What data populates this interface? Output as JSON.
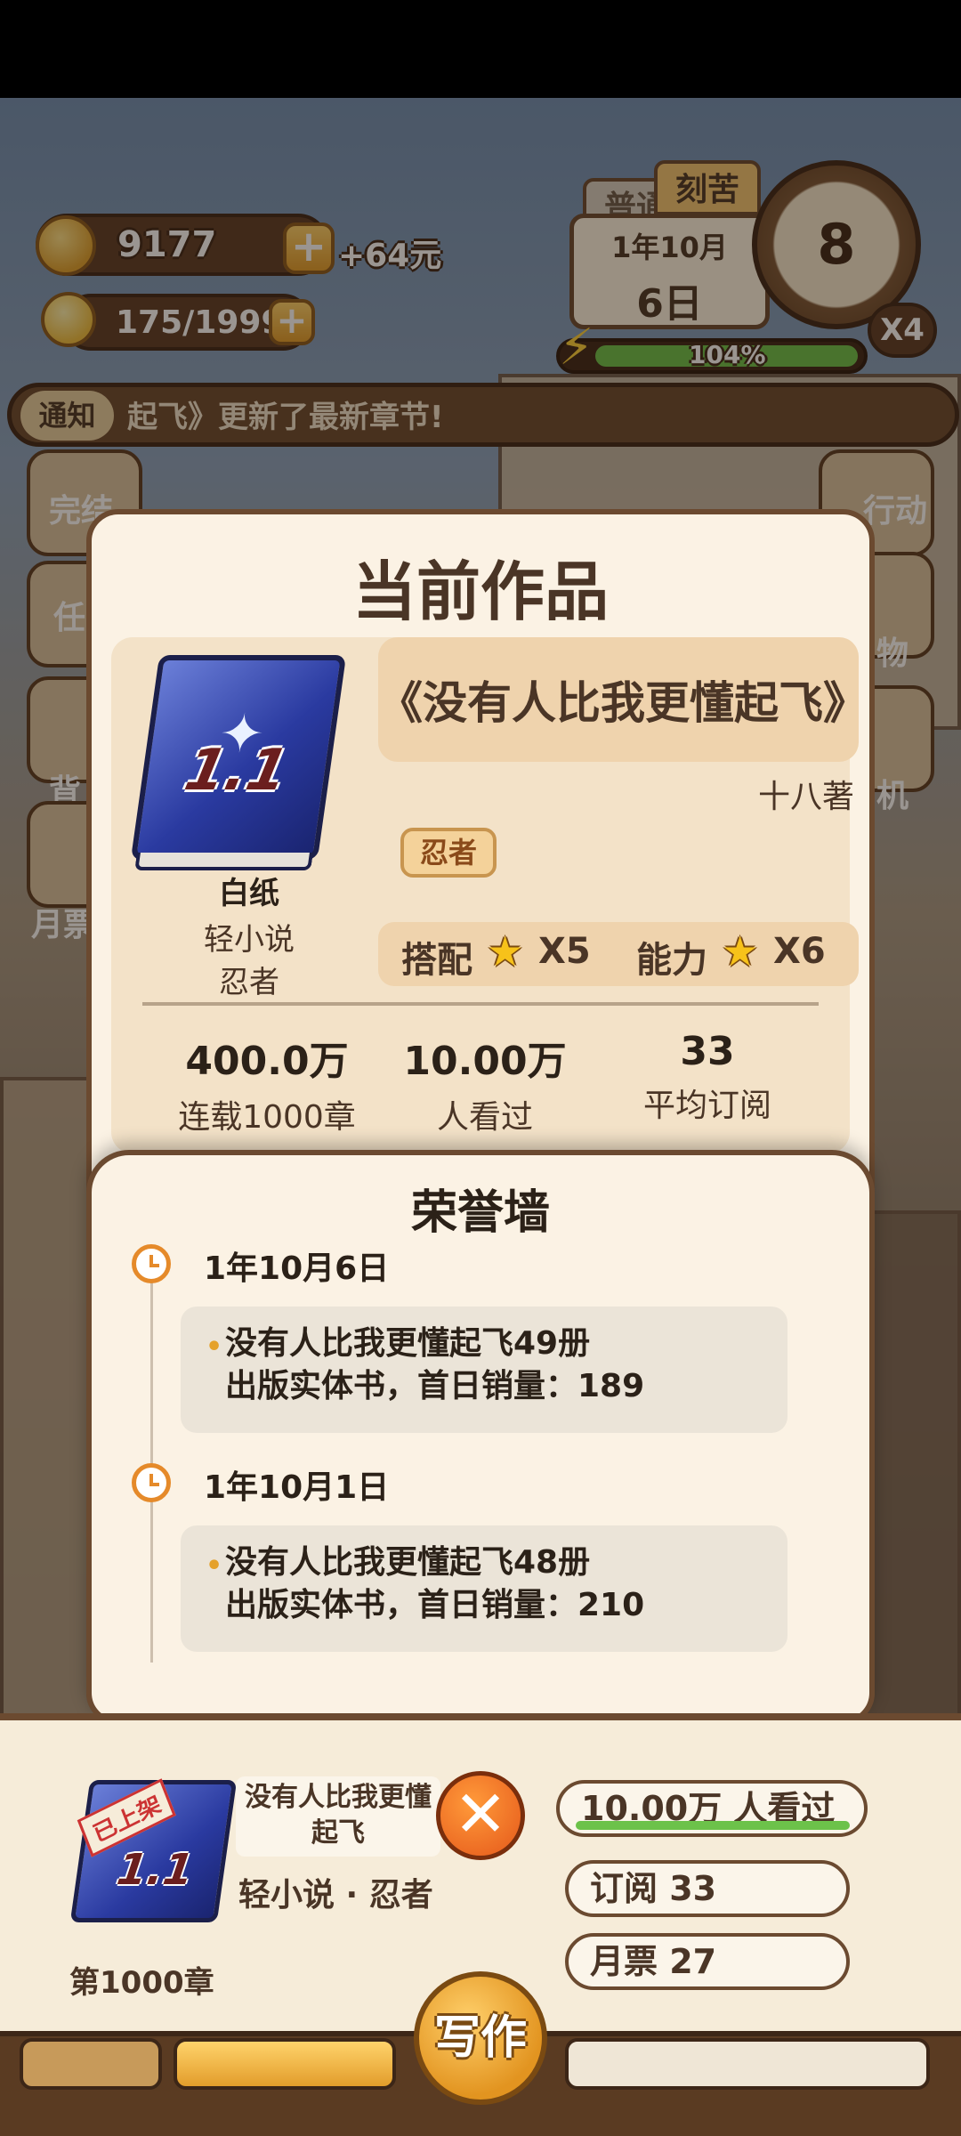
{
  "hud": {
    "coins": "9177",
    "coins_bonus": "+64元",
    "energy": "175/1999",
    "mode_tags": [
      "普通",
      "刻苦"
    ],
    "date_month": "1年10月",
    "date_day": "6日",
    "stamina_percent": "104%",
    "stamina_fill": 1.0,
    "clock_value": "8",
    "speed": "X4"
  },
  "notice": {
    "label": "通知",
    "text": "起飞》更新了最新章节!"
  },
  "side_menu": {
    "left": [
      "完结",
      "任",
      "背",
      "月票"
    ],
    "right": [
      "行动",
      "物",
      "机"
    ]
  },
  "work": {
    "title": "当前作品",
    "book_cover_number": "1.1",
    "book_title": "《没有人比我更懂起飞》",
    "author": "十八著",
    "paper_grade": "白纸",
    "category": "轻小说",
    "subgenre": "忍者",
    "genre_chip": "忍者",
    "match_label": "搭配",
    "match_value": "X5",
    "ability_label": "能力",
    "ability_value": "X6",
    "stats": [
      {
        "value": "400.0万",
        "label": "连载1000章"
      },
      {
        "value": "10.00万",
        "label": "人看过"
      },
      {
        "value": "33",
        "label": "平均订阅"
      }
    ]
  },
  "honor_wall": {
    "title": "荣誉墙",
    "entries": [
      {
        "date": "1年10月6日",
        "line1": "没有人比我更懂起飞49册",
        "line2": "出版实体书，首日销量：189"
      },
      {
        "date": "1年10月1日",
        "line1": "没有人比我更懂起飞48册",
        "line2": "出版实体书，首日销量：210"
      }
    ]
  },
  "bottom_panel": {
    "shelf_badge": "已上架",
    "book_title": "没有人比我更懂起飞",
    "genre_line": "轻小说 · 忍者",
    "chapter": "第1000章",
    "views": "10.00万 人看过",
    "subscriptions": "订阅 33",
    "monthly_votes": "月票 27",
    "write_label": "写作"
  },
  "colors": {
    "accent": "#e58a2a",
    "panel": "#fbf2e4",
    "border": "#6b4a30"
  }
}
